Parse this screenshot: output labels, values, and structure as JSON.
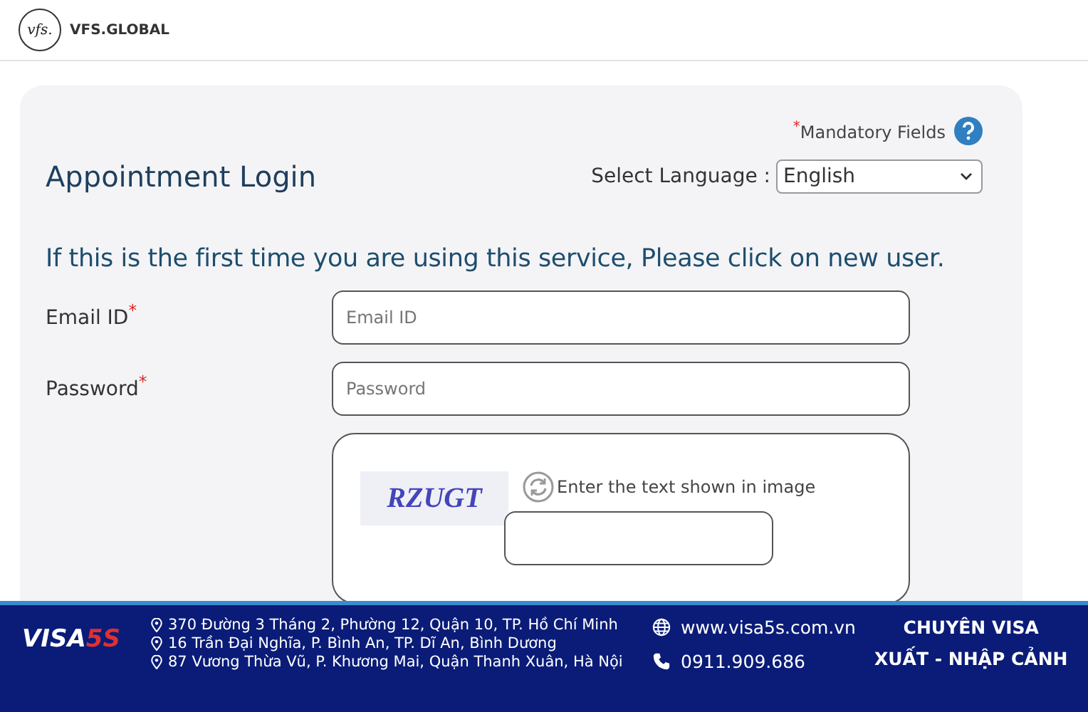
{
  "header": {
    "logo_mark": "vfs.",
    "brand": "VFS.GLOBAL"
  },
  "login": {
    "required_mark": "*",
    "mandatory_note": "Mandatory Fields",
    "title": "Appointment Login",
    "language_label": "Select Language :",
    "language": "English",
    "intro": "If this is the first time you are using this service, Please click on new user.",
    "fields": [
      {
        "label": "Email ID",
        "required_mark": "*",
        "placeholder": "Email ID"
      },
      {
        "label": "Password",
        "required_mark": "*",
        "placeholder": "Password"
      }
    ],
    "captcha": {
      "image_text": "RZUGT",
      "prompt": "Enter the text shown in image"
    }
  },
  "banner": {
    "logo_text": "VISA",
    "logo_accent": "5S",
    "addresses": [
      "370 Đường 3 Tháng 2, Phường 12, Quận 10, TP. Hồ Chí Minh",
      "16 Trần Đại Nghĩa, P. Bình An, TP. Dĩ An, Bình Dương",
      "87 Vương Thừa Vũ, P. Khương Mai, Quận Thanh Xuân, Hà Nội"
    ],
    "website": "www.visa5s.com.vn",
    "phone": "0911.909.686",
    "slogan": [
      "CHUYÊN VISA",
      "XUẤT - NHẬP CẢNH"
    ]
  }
}
